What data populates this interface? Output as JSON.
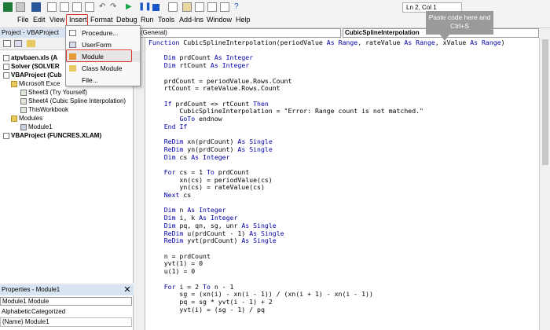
{
  "menubar": {
    "items": [
      "File",
      "Edit",
      "View",
      "Insert",
      "Format",
      "Debug",
      "Run",
      "Tools",
      "Add-Ins",
      "Window",
      "Help"
    ],
    "status": "Ln 2, Col 1"
  },
  "project": {
    "title": "Project - VBAProject",
    "tree": [
      "atpvbaen.xls (A",
      "Solver (SOLVER",
      "VBAProject (Cub",
      "Microsoft Exce",
      "Sheet3 (Try Yourself)",
      "Sheet4 (Cubic Spline Interpolation)",
      "ThisWorkbook",
      "Modules",
      "Module1",
      "VBAProject (FUNCRES.XLAM)"
    ]
  },
  "properties": {
    "title": "Properties - Module1",
    "object": "Module1 Module",
    "tabs": [
      "Alphabetic",
      "Categorized"
    ],
    "row": "(Name) Module1"
  },
  "codeheader": {
    "object": "(General)",
    "procedure": "CubicSplineInterpolation"
  },
  "insert_menu": {
    "items": [
      "Procedure...",
      "UserForm",
      "Module",
      "Class Module",
      "File..."
    ]
  },
  "callout": "Paste code here and Ctrl+S",
  "code_lines": [
    "Function CubicSplineInterpolation(periodValue As Range, rateValue As Range, xValue As Range)",
    "",
    "    Dim prdCount As Integer",
    "    Dim rtCount As Integer",
    "",
    "    prdCount = periodValue.Rows.Count",
    "    rtCount = rateValue.Rows.Count",
    "",
    "    If prdCount <> rtCount Then",
    "        CubicSplineInterpolation = \"Error: Range count is not matched.\"",
    "        GoTo endnow",
    "    End If",
    "",
    "    ReDim xn(prdCount) As Single",
    "    ReDim yn(prdCount) As Single",
    "    Dim cs As Integer",
    "",
    "    For cs = 1 To prdCount",
    "        xn(cs) = periodValue(cs)",
    "        yn(cs) = rateValue(cs)",
    "    Next cs",
    "",
    "    Dim n As Integer",
    "    Dim i, k As Integer",
    "    Dim pq, qn, sg, unr As Single",
    "    ReDim u(prdCount - 1) As Single",
    "    ReDim yvt(prdCount) As Single",
    "",
    "    n = prdCount",
    "    yvt(1) = 0",
    "    u(1) = 0",
    "",
    "    For i = 2 To n - 1",
    "        sg = (xn(i) - xn(i - 1)) / (xn(i + 1) - xn(i - 1))",
    "        pq = sg * yvt(i - 1) + 2",
    "        yvt(i) = (sg - 1) / pq"
  ]
}
